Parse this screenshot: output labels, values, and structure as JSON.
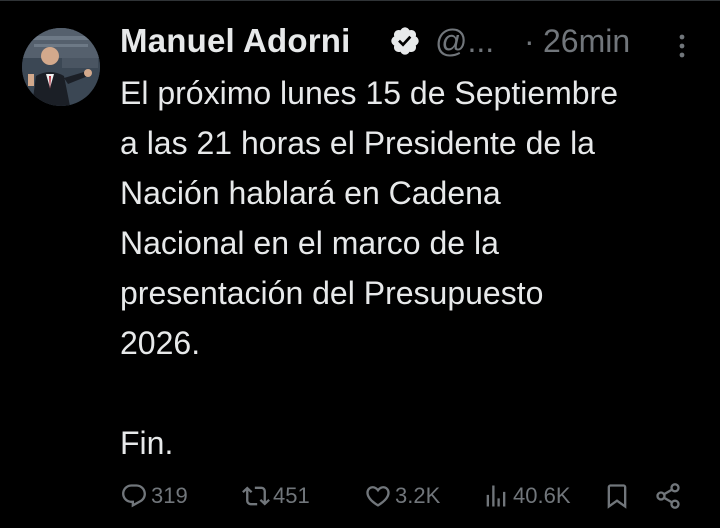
{
  "tweet": {
    "author": {
      "display_name": "Manuel Adorni",
      "handle": "@...",
      "verified": true,
      "avatar_icon": "profile-photo"
    },
    "time_separator": "·",
    "time": "26min",
    "lines": [
      "El próximo lunes 15 de Septiembre",
      "a las 21 horas el Presidente de la",
      "Nación hablará en Cadena",
      "Nacional en el marco de la",
      "presentación del Presupuesto",
      "2026."
    ],
    "closing": "Fin."
  },
  "actions": {
    "reply": {
      "icon": "reply-icon",
      "count": "319"
    },
    "retweet": {
      "icon": "retweet-icon",
      "count": "451"
    },
    "like": {
      "icon": "heart-icon",
      "count": "3.2K"
    },
    "views": {
      "icon": "views-icon",
      "count": "40.6K"
    },
    "bookmark": {
      "icon": "bookmark-icon"
    },
    "share": {
      "icon": "share-icon"
    }
  },
  "colors": {
    "background": "#000000",
    "text": "#e7e9ea",
    "muted": "#71767b",
    "verified": "#1d9bf0"
  }
}
